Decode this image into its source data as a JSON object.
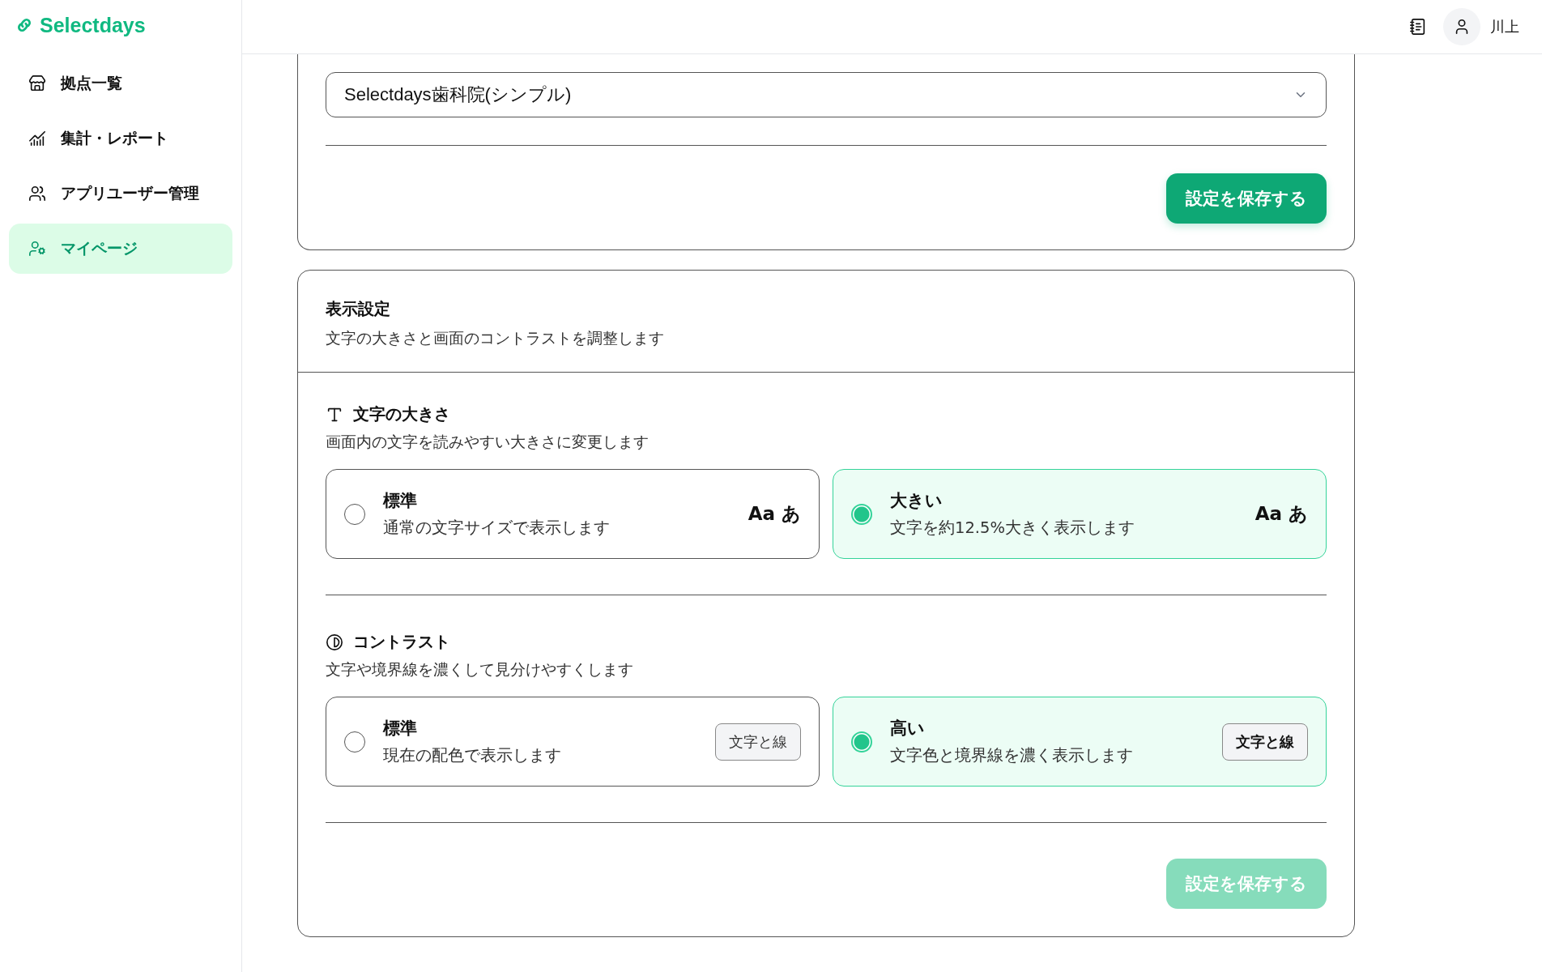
{
  "sidebar": {
    "logo": "Selectdays",
    "items": [
      {
        "label": "拠点一覧",
        "selected": false
      },
      {
        "label": "集計・レポート",
        "selected": false
      },
      {
        "label": "アプリユーザー管理",
        "selected": false
      },
      {
        "label": "マイページ",
        "selected": true
      }
    ]
  },
  "header": {
    "user": "川上"
  },
  "redirect_card": {
    "select_value": "Selectdays歯科院(シンプル)",
    "save_button": {
      "label": "設定を保存する",
      "disabled": false
    }
  },
  "display_card": {
    "title": "表示設定",
    "description": "文字の大きさと画面のコントラストを調整します",
    "sections": [
      {
        "kind": "size",
        "title": "文字の大きさ",
        "description": "画面内の文字を読みやすい大きさに変更します",
        "options": [
          {
            "title": "標準",
            "description": "通常の文字サイズで表示します",
            "preview": {
              "kind": "sample",
              "text": "Aa あ"
            },
            "selected": false
          },
          {
            "title": "大きい",
            "description": "文字を約12.5%大きく表示します",
            "preview": {
              "kind": "sample",
              "text": "Aa あ"
            },
            "selected": true
          }
        ]
      },
      {
        "kind": "contrast",
        "title": "コントラスト",
        "description": "文字や境界線を濃くして見分けやすくします",
        "options": [
          {
            "title": "標準",
            "description": "現在の配色で表示します",
            "preview": {
              "kind": "tag",
              "text": "文字と線"
            },
            "selected": false
          },
          {
            "title": "高い",
            "description": "文字色と境界線を濃く表示します",
            "preview": {
              "kind": "tag",
              "text": "文字と線"
            },
            "selected": true
          }
        ]
      }
    ],
    "save_button": {
      "label": "設定を保存する",
      "disabled": true
    }
  }
}
